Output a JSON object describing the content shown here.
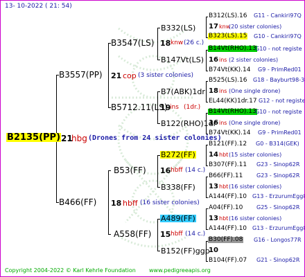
{
  "header": {
    "date": "13- 10-2022 ( 21: 54)"
  },
  "footer": {
    "copyright": "Copyright 2004-2022 © Karl Kehrle Foundation",
    "website": "www.pedigreeapis.org"
  },
  "colors": {
    "border": "#cc00cc",
    "blue": "#1a1aa6",
    "red": "#cc0000",
    "yellow": "#ffff00",
    "green": "#00cc00",
    "cyan": "#33ccff",
    "gray": "#999999"
  },
  "root": {
    "id": "B2135(PP)",
    "gen": "21",
    "note": "hbg",
    "sisters": "(Drones from 24 sister colonies)"
  },
  "gen1": {
    "sire": {
      "id": "B3557(PP)",
      "gen": "21",
      "note": "cop",
      "sisters": "(3 sister colonies)"
    },
    "dam": {
      "id": "B466(FF)",
      "gen": "18",
      "note": "hbff",
      "sisters": "(16 sister colonies)"
    }
  },
  "gen2": {
    "a": {
      "id": "B3547(LS)",
      "gen": "18",
      "note": "knw",
      "sisters": "(26 c.)"
    },
    "b": {
      "id": "B5712.11(LS)",
      "gen": "19",
      "note": "ins",
      "sisters": "(1dr.)"
    },
    "c": {
      "id": "B53(FF)",
      "gen": "16",
      "note": "hbff",
      "sisters": "(14 c.)"
    },
    "d": {
      "id": "A558(FF)",
      "gen": "15",
      "note": "hbff",
      "sisters": "(14 c.)"
    }
  },
  "gen3": {
    "a": {
      "id": "B332(LS)"
    },
    "b": {
      "id": "B147Vt(LS)"
    },
    "c": {
      "id": "B7(ABK)1dr"
    },
    "d": {
      "id": "B122(RHO)1dr"
    },
    "e": {
      "id": "B272(FF)"
    },
    "f": {
      "id": "B338(FF)"
    },
    "g": {
      "id": "A489(FF)"
    },
    "h": {
      "id": "B152(FF)ggp"
    }
  },
  "gen4": [
    {
      "id": "B312(LS).16",
      "ref": "G11 - Cankiri97Q"
    },
    {
      "gen": "17",
      "note": "knw",
      "sisters": "(20 sister colonies)"
    },
    {
      "id": "B323(LS).15",
      "ref": "G10 - Cankiri97Q"
    },
    {
      "id": "B14Vt(RHO).13",
      "ref": "G10 - not registe"
    },
    {
      "gen": "16",
      "note": "ins",
      "sisters": "(2 sister colonies)"
    },
    {
      "id": "B74Vt(KK).14",
      "ref": "G9 - PrimRed01"
    },
    {
      "id": "B525(LS).16",
      "ref": "G18 - Bayburt98-3"
    },
    {
      "gen": "18",
      "note": "ins",
      "sisters": "(One single drone)"
    },
    {
      "id": "EL44(KK)1dr.17",
      "ref": "G12 - not registe"
    },
    {
      "id": "B14Vt(RHO).13",
      "ref": "G10 - not registe"
    },
    {
      "gen": "16",
      "note": "ins",
      "sisters": "(One single drone)"
    },
    {
      "id": "B74Vt(KK).14",
      "ref": "G9 - PrimRed01"
    },
    {
      "id": "B121(FF).12",
      "ref": "G0 - B314(GEK)"
    },
    {
      "gen": "14",
      "note": "hbt",
      "sisters": "(15 sister colonies)"
    },
    {
      "id": "B307(FF).11",
      "ref": "G23 - Sinop62R"
    },
    {
      "id": "B66(FF).11",
      "ref": "G23 - Sinop62R"
    },
    {
      "gen": "13",
      "note": "hbt",
      "sisters": "(16 sister colonies)"
    },
    {
      "id": "A144(FF).10",
      "ref": "G13 - ErzurumEgg8"
    },
    {
      "id": "A04(FF).10",
      "ref": "G25 - Sinop62R"
    },
    {
      "gen": "13",
      "note": "hbt",
      "sisters": "(16 sister colonies)"
    },
    {
      "id": "A144(FF).10",
      "ref": "G13 - ErzurumEgg8"
    },
    {
      "id": "B30(FF).08",
      "ref": "G16 - Longos77R"
    },
    {
      "gen": "10",
      "note": "",
      "sisters": ""
    },
    {
      "id": "B104(FF).07",
      "ref": "G21 - Sinop62R"
    }
  ]
}
